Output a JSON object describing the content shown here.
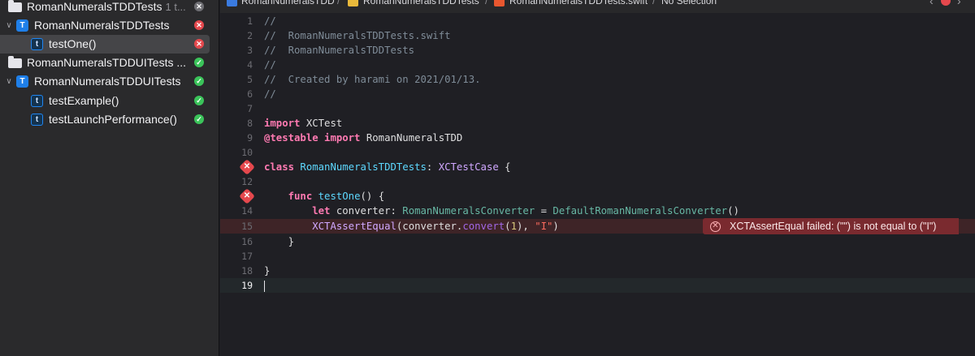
{
  "navigator": {
    "rows": [
      {
        "label": "RomanNumeralsTDDTests",
        "count": "1 t...",
        "status": "skip"
      },
      {
        "label": "RomanNumeralsTDDTests",
        "badge": "T",
        "status": "fail"
      },
      {
        "label": "testOne()",
        "badge": "t",
        "status": "fail"
      },
      {
        "label": "RomanNumeralsTDDUITests ...",
        "status": "pass"
      },
      {
        "label": "RomanNumeralsTDDUITests",
        "badge": "T",
        "status": "pass"
      },
      {
        "label": "testExample()",
        "badge": "t",
        "status": "pass"
      },
      {
        "label": "testLaunchPerformance()",
        "badge": "t",
        "status": "pass"
      }
    ]
  },
  "jumpbar": {
    "project": "RomanNumeralsTDD",
    "group": "RomanNumeralsTDDTests",
    "file": "RomanNumeralsTDDTests.swift",
    "selection": "No Selection",
    "separator": "/"
  },
  "editor": {
    "line_numbers": [
      "1",
      "2",
      "3",
      "4",
      "5",
      "6",
      "7",
      "8",
      "9",
      "10",
      "11",
      "12",
      "13",
      "14",
      "15",
      "16",
      "17",
      "18",
      "19"
    ],
    "error_glyph": "✕",
    "tokens": {
      "l1": "//",
      "l2": "//  RomanNumeralsTDDTests.swift",
      "l3": "//  RomanNumeralsTDDTests",
      "l4": "//",
      "l5": "//  Created by harami on 2021/01/13.",
      "l6": "//",
      "l8_kw": "import",
      "l8_rest": " XCTest",
      "l9_attr": "@testable",
      "l9_kw": " import",
      "l9_rest": " RomanNumeralsTDD",
      "l11_kw": "class",
      "l11_name": " RomanNumeralsTDDTests",
      "l11_colon": ": ",
      "l11_type": "XCTestCase",
      "l11_brace": " {",
      "l13_indent": "    ",
      "l13_kw": "func",
      "l13_name": " testOne",
      "l13_rest": "() {",
      "l14_indent": "        ",
      "l14_kw": "let",
      "l14_var": " converter: ",
      "l14_type": "RomanNumeralsConverter",
      "l14_eq": " = ",
      "l14_type2": "DefaultRomanNumeralsConverter",
      "l14_rest": "()",
      "l15_indent": "        ",
      "l15_func": "XCTAssertEqual",
      "l15_open": "(converter.",
      "l15_method": "convert",
      "l15_p": "(",
      "l15_num": "1",
      "l15_mid": "), ",
      "l15_str": "\"I\"",
      "l15_close": ")",
      "l16": "    }",
      "l18": "}"
    },
    "error_message": "XCTAssertEqual failed: (\"\") is not equal to (\"I\")"
  },
  "colors": {
    "fail": "#e5484d",
    "pass": "#3bc45a",
    "keyword": "#ff7ab2",
    "comment": "#7f8c98",
    "error_banner": "#7a2a2f"
  }
}
